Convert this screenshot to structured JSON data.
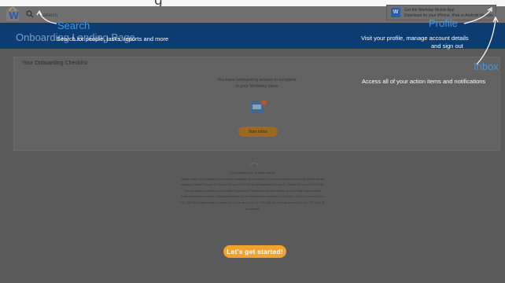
{
  "window": {
    "top_title_fragment": "g"
  },
  "header": {
    "logo_letter": "W",
    "search": {
      "placeholder": "Search"
    },
    "mobile_banner": {
      "icon_letter": "W",
      "line1": "Get the Workday Mobile App",
      "line2": "Download for your iPhone, iPad or Android devices"
    }
  },
  "page": {
    "title": "Onboarding Landing Page"
  },
  "checklist": {
    "title": "Your Onboarding Checklist",
    "message_line1": "You have onboarding actions to complete",
    "message_line2": "in your Workday inbox",
    "button_label": "Start Inbox"
  },
  "footer": {
    "copyright": "© 2018 Workday, Inc. All rights reserved.",
    "lines": [
      "System Status: Your Sandbox Preview will be unavailable for a maximum of 12 hours during the next Weekly Service update",
      "starting on Friday, February 16, 2018 at 6:00 p.m. PST (GMT-8) until Saturday, February 17, 2018 at 6:00 a.m. PST (GMT-8).",
      "You can request a refresh of your Sandbox Preview from Production in Sandbox during one of the daily Implementation",
      "Tenant Maintenance windows. Daily Implementation Tenant Maintenance is performed at 2:00 a.m., 10:00 a.m., and 6:00 p.m.",
      "PST (GMT-8) Sunday through Thursday, at 2:00 a.m. and 10:00 a.m. PST (GMT-8) on Friday, and at 10:00 a.m. PST (GMT-8)",
      "on Saturday."
    ]
  },
  "coach": {
    "search_title": "Search",
    "search_desc": "Search for people, tasks, reports and more",
    "profile_title": "Profile",
    "profile_desc_line1": "Visit your profile, manage account details",
    "profile_desc_line2": "and sign out",
    "inbox_title": "Inbox",
    "inbox_desc": "Access all of your action items and notifications",
    "cta_label": "Let's get started!"
  },
  "colors": {
    "brand_blue": "#0c3c72",
    "accent_orange": "#f2a32e",
    "callout_blue": "#3f9ae2"
  }
}
